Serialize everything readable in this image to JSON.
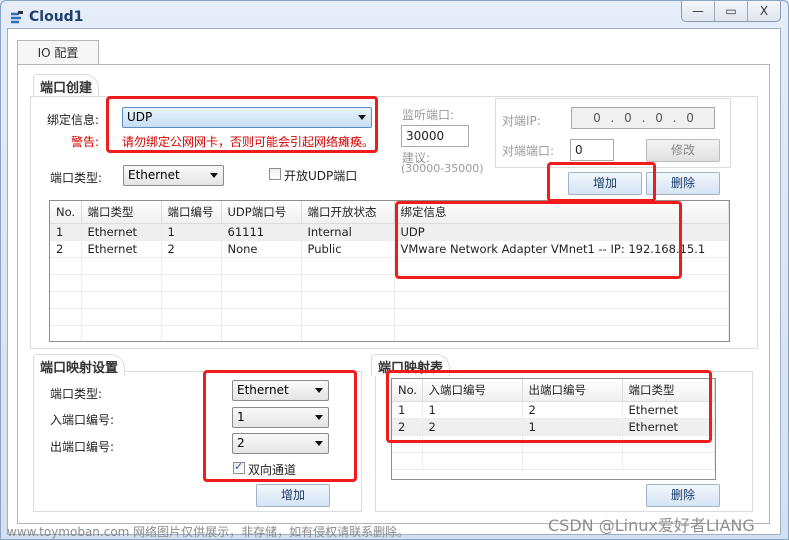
{
  "window": {
    "title": "Cloud1",
    "controls": [
      "—",
      "▭",
      "X"
    ]
  },
  "tabs": [
    {
      "label": "IO 配置"
    }
  ],
  "port_create": {
    "title": "端口创建",
    "bind_label": "绑定信息:",
    "bind_value": "UDP",
    "warning_label": "警告:",
    "warning_text": "请勿绑定公网网卡，否则可能会引起网络瘫痪。",
    "port_type_label": "端口类型:",
    "port_type_value": "Ethernet",
    "open_udp_label": "开放UDP端口",
    "open_udp_checked": false,
    "listen_port_label": "监听端口:",
    "listen_port_value": "30000",
    "suggest_label": "建议:",
    "suggest_range": "(30000-35000)",
    "peer_ip_label": "对端IP:",
    "peer_ip_value": "0 . 0 . 0 . 0",
    "peer_port_label": "对端端口:",
    "peer_port_value": "0",
    "modify_button": "修改",
    "add_button": "增加",
    "delete_button": "删除",
    "table": {
      "headers": [
        "No.",
        "端口类型",
        "端口编号",
        "UDP端口号",
        "端口开放状态",
        "绑定信息"
      ],
      "rows": [
        [
          "1",
          "Ethernet",
          "1",
          "61111",
          "Internal",
          "UDP"
        ],
        [
          "2",
          "Ethernet",
          "2",
          "None",
          "Public",
          "VMware Network Adapter VMnet1 -- IP: 192.168.15.1"
        ]
      ]
    }
  },
  "port_mapping": {
    "title": "端口映射设置",
    "port_type_label": "端口类型:",
    "port_type_value": "Ethernet",
    "in_port_label": "入端口编号:",
    "in_port_value": "1",
    "out_port_label": "出端口编号:",
    "out_port_value": "2",
    "bidirectional_label": "双向通道",
    "bidirectional_checked": true,
    "add_button": "增加"
  },
  "mapping_table": {
    "title": "端口映射表",
    "headers": [
      "No.",
      "入端口编号",
      "出端口编号",
      "端口类型"
    ],
    "rows": [
      [
        "1",
        "1",
        "2",
        "Ethernet"
      ],
      [
        "2",
        "2",
        "1",
        "Ethernet"
      ]
    ],
    "delete_button": "删除"
  },
  "watermarks": {
    "left": "www.toymoban.com 网络图片仅供展示，非存储，如有侵权请联系删除。",
    "right": "CSDN @Linux爱好者LIANG"
  },
  "highlight_color": "#f21b1b"
}
